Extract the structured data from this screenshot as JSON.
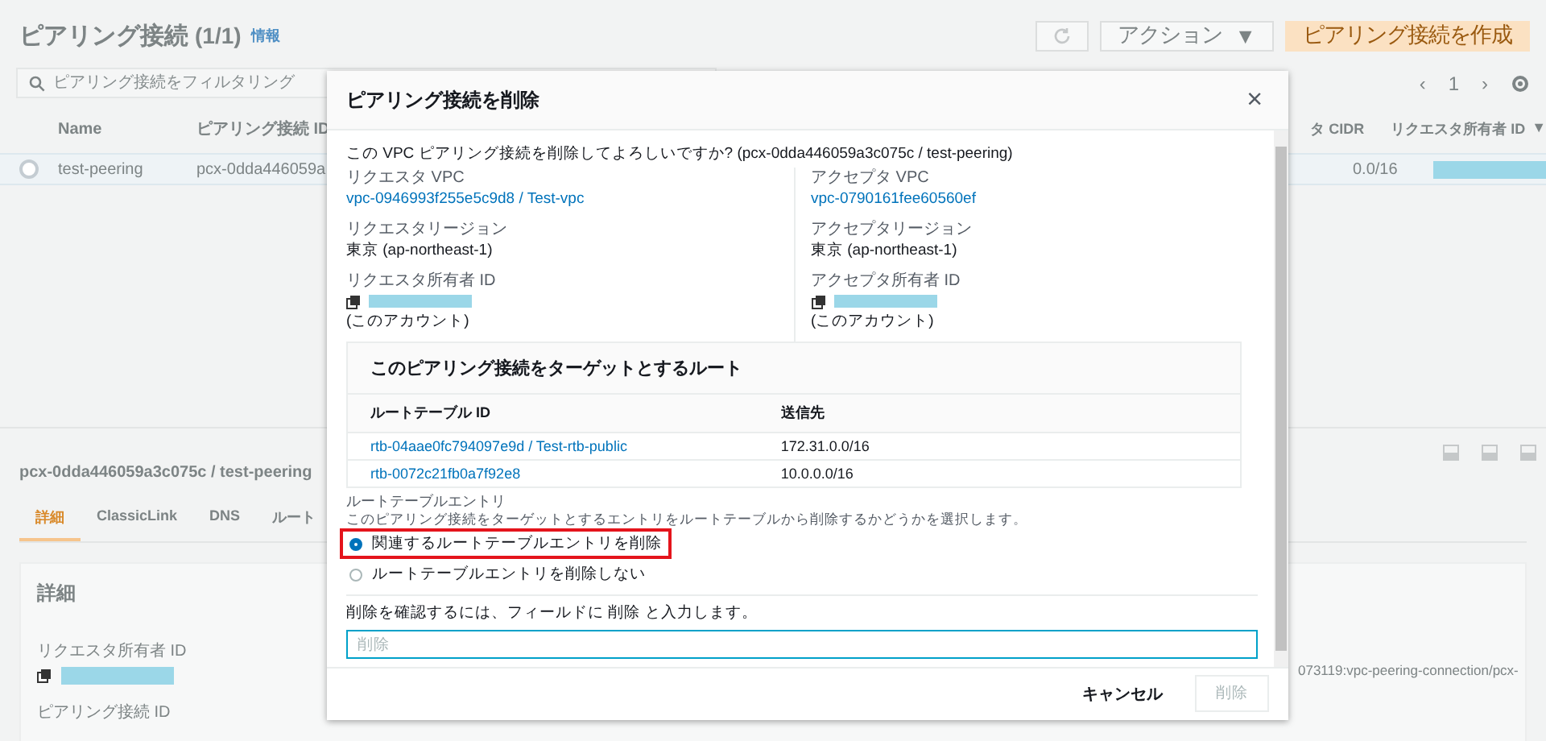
{
  "background": {
    "title": "ピアリング接続",
    "count": "(1/1)",
    "info_link": "情報",
    "actions_button": "アクション",
    "actions_caret": "▼",
    "create_button": "ピアリング接続を作成",
    "search": {
      "placeholder": "ピアリング接続をフィルタリング"
    },
    "pagination": {
      "prev": "‹",
      "page": "1",
      "next": "›"
    },
    "table": {
      "left_columns": [
        "Name",
        "ピアリング接続 ID"
      ],
      "right_columns": [
        "タ CIDR",
        "リクエスタ所有者 ID"
      ],
      "sort_mark": "▼",
      "rows": [
        {
          "selected": false,
          "name": "test-peering",
          "id": "pcx-0dda446059a",
          "cidr": "0.0/16"
        }
      ]
    },
    "detail": {
      "title": "pcx-0dda446059a3c075c / test-peering",
      "tabs": [
        {
          "label": "詳細",
          "selected": true
        },
        {
          "label": "ClassicLink",
          "selected": false
        },
        {
          "label": "DNS",
          "selected": false
        },
        {
          "label": "ルート",
          "selected": false
        }
      ],
      "section_title": "詳細",
      "fields": [
        {
          "label": "リクエスタ所有者 ID"
        },
        {
          "label": "ピアリング接続 ID"
        }
      ],
      "arn_fragment": "073119:vpc-peering-connection/pcx-"
    }
  },
  "modal": {
    "title": "ピアリング接続を削除",
    "close": "×",
    "intro": "この VPC ピアリング接続を削除してよろしいですか? (pcx-0dda446059a3c075c / test-peering)",
    "columns": [
      {
        "fields": [
          {
            "kind": "link",
            "label": "リクエスタ VPC",
            "value": "vpc-0946993f255e5c9d8 / Test-vpc"
          },
          {
            "kind": "text",
            "label": "リクエスタリージョン",
            "value": "東京 (ap-northeast-1)"
          },
          {
            "kind": "owner",
            "label": "リクエスタ所有者 ID",
            "value": "(このアカウント)"
          }
        ]
      },
      {
        "fields": [
          {
            "kind": "link",
            "label": "アクセプタ VPC",
            "value": "vpc-0790161fee60560ef"
          },
          {
            "kind": "text",
            "label": "アクセプタリージョン",
            "value": "東京 (ap-northeast-1)"
          },
          {
            "kind": "owner",
            "label": "アクセプタ所有者 ID",
            "value": "(このアカウント)"
          }
        ]
      }
    ],
    "routes": {
      "title": "このピアリング接続をターゲットとするルート",
      "columns": [
        "ルートテーブル ID",
        "送信先"
      ],
      "rows": [
        {
          "table": "rtb-04aae0fc794097e9d / Test-rtb-public",
          "destination": "172.31.0.0/16"
        },
        {
          "table": "rtb-0072c21fb0a7f92e8",
          "destination": "10.0.0.0/16"
        }
      ]
    },
    "entry_label": "ルートテーブルエントリ",
    "entry_description": "このピアリング接続をターゲットとするエントリをルートテーブルから削除するかどうかを選択します。",
    "options": [
      {
        "label": "関連するルートテーブルエントリを削除",
        "selected": true,
        "highlighted": true
      },
      {
        "label": "ルートテーブルエントリを削除しない",
        "selected": false,
        "highlighted": false
      }
    ],
    "confirm_label": "削除を確認するには、フィールドに 削除 と入力します。",
    "confirm_field": {
      "placeholder": "削除"
    },
    "cancel": "キャンセル",
    "delete_button": {
      "label": "削除",
      "disabled": true
    }
  }
}
